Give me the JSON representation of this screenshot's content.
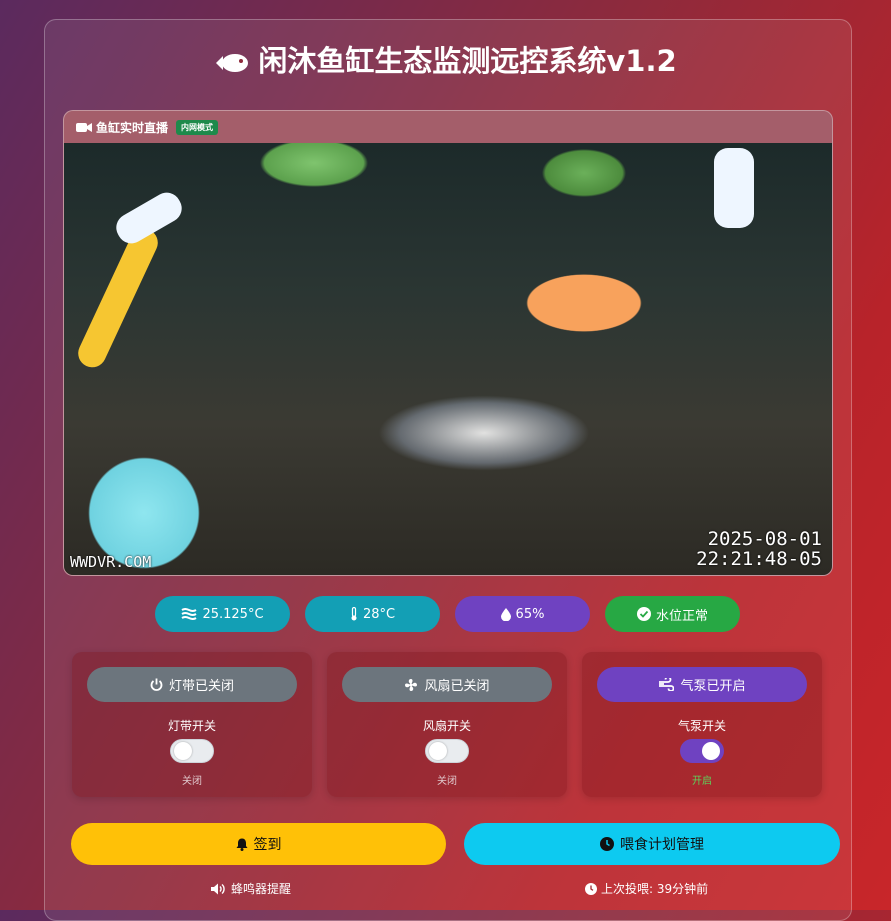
{
  "app": {
    "title": "闲沐鱼缸生态监测远控系统v1.2"
  },
  "video": {
    "title": "鱼缸实时直播",
    "badge": "内网模式",
    "timestamp_date": "2025-08-01",
    "timestamp_time": "22:21:48-05",
    "watermark": "WWDVR.COM"
  },
  "sensors": [
    {
      "label": "25.125°C",
      "icon": "water-wave-icon",
      "color": "#139fb5"
    },
    {
      "label": "28°C",
      "icon": "thermometer-icon",
      "color": "#139fb5"
    },
    {
      "label": "65%",
      "icon": "droplet-icon",
      "color": "#6f42c1"
    },
    {
      "label": "水位正常",
      "icon": "check-circle-icon",
      "color": "#27a844"
    }
  ],
  "controls": [
    {
      "button": "灯带已关闭",
      "switch_label": "灯带开关",
      "state": "关闭",
      "on": false,
      "icon": "power-icon"
    },
    {
      "button": "风扇已关闭",
      "switch_label": "风扇开关",
      "state": "关闭",
      "on": false,
      "icon": "fan-icon"
    },
    {
      "button": "气泵已开启",
      "switch_label": "气泵开关",
      "state": "开启",
      "on": true,
      "icon": "wind-icon"
    }
  ],
  "actions": {
    "checkin": "签到",
    "feeding": "喂食计划管理"
  },
  "footer": {
    "buzzer": "蜂鸣器提醒",
    "last_feed": "上次投喂: 39分钟前"
  }
}
